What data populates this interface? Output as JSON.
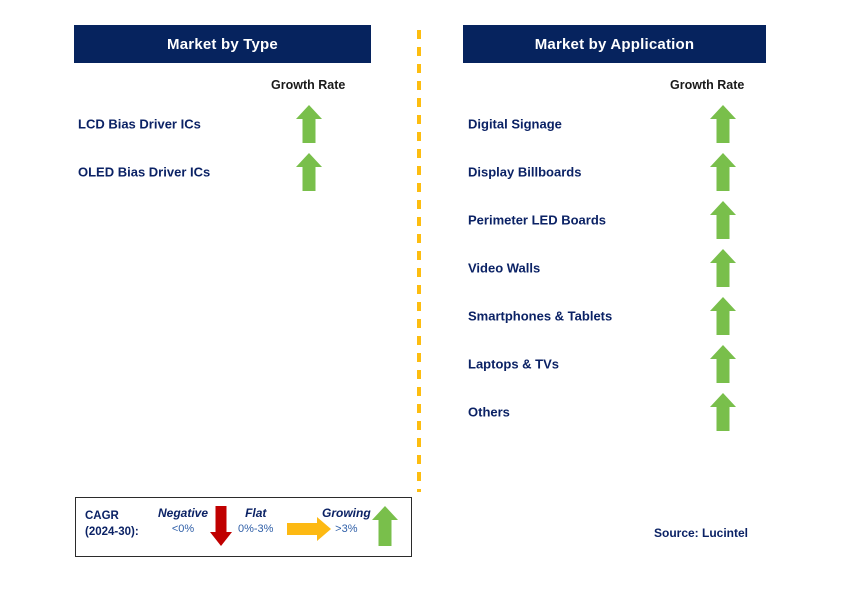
{
  "meta": {
    "navy": "#06235e",
    "label_navy": "#0b2265",
    "green": "#79bf4b",
    "red": "#c00000",
    "orange": "#fdb913",
    "divider_yellow": "#fdbd10"
  },
  "columns": [
    {
      "title": "Market by Type",
      "growth_caption": "Growth Rate",
      "rows": [
        {
          "label": "LCD Bias Driver ICs",
          "trend": "growing",
          "icon": "arrow-up-icon"
        },
        {
          "label": "OLED Bias Driver ICs",
          "trend": "growing",
          "icon": "arrow-up-icon"
        }
      ]
    },
    {
      "title": "Market by Application",
      "growth_caption": "Growth Rate",
      "rows": [
        {
          "label": "Digital Signage",
          "trend": "growing",
          "icon": "arrow-up-icon"
        },
        {
          "label": "Display Billboards",
          "trend": "growing",
          "icon": "arrow-up-icon"
        },
        {
          "label": "Perimeter LED Boards",
          "trend": "growing",
          "icon": "arrow-up-icon"
        },
        {
          "label": "Video Walls",
          "trend": "growing",
          "icon": "arrow-up-icon"
        },
        {
          "label": "Smartphones & Tablets",
          "trend": "growing",
          "icon": "arrow-up-icon"
        },
        {
          "label": "Laptops & TVs",
          "trend": "growing",
          "icon": "arrow-up-icon"
        },
        {
          "label": "Others",
          "trend": "growing",
          "icon": "arrow-up-icon"
        }
      ]
    }
  ],
  "legend": {
    "cagr_line1": "CAGR",
    "cagr_line2": "(2024-30):",
    "items": [
      {
        "term": "Negative",
        "range": "<0%",
        "icon": "arrow-down-icon",
        "color": "#c00000"
      },
      {
        "term": "Flat",
        "range": "0%-3%",
        "icon": "arrow-right-icon",
        "color": "#fdb913"
      },
      {
        "term": "Growing",
        "range": ">3%",
        "icon": "arrow-up-icon",
        "color": "#79bf4b"
      }
    ]
  },
  "source": "Source: Lucintel"
}
